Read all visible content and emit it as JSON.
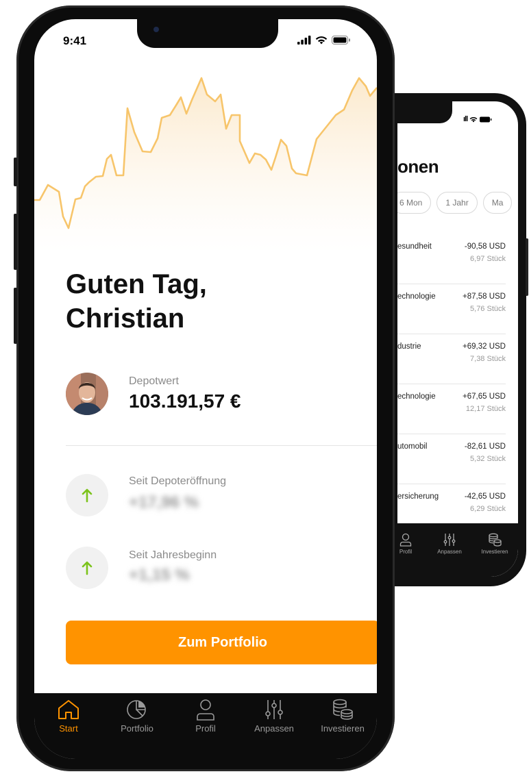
{
  "back": {
    "status_signal": "ıll",
    "title": "onen",
    "filters": [
      "",
      "6 Mon",
      "1 Jahr",
      "Ma"
    ],
    "rows": [
      {
        "sector": "esundheit",
        "amount": "-90,58 USD",
        "qty": "6,97 Stück"
      },
      {
        "sector": "echnologie",
        "amount": "+87,58 USD",
        "qty": "5,76 Stück"
      },
      {
        "sector": "dustrie",
        "amount": "+69,32 USD",
        "qty": "7,38 Stück"
      },
      {
        "sector": "echnologie",
        "amount": "+67,65 USD",
        "qty": "12,17 Stück"
      },
      {
        "sector": "utomobil",
        "amount": "-82,61 USD",
        "qty": "5,32 Stück"
      },
      {
        "sector": "ersicherung",
        "amount": "-42,65 USD",
        "qty": "6,29 Stück"
      }
    ],
    "nav": [
      "Profil",
      "Anpassen",
      "Investieren"
    ]
  },
  "front": {
    "time": "9:41",
    "greeting_line1": "Guten Tag,",
    "greeting_line2": "Christian",
    "depot_label": "Depotwert",
    "depot_value": "103.191,57 €",
    "since_opening_label": "Seit Depoteröffnung",
    "since_opening_value": "+17,96 %",
    "since_year_label": "Seit Jahresbeginn",
    "since_year_value": "+1,15 %",
    "cta": "Zum Portfolio",
    "nav": [
      {
        "label": "Start",
        "icon": "home-icon",
        "active": true
      },
      {
        "label": "Portfolio",
        "icon": "pie-chart-icon",
        "active": false
      },
      {
        "label": "Profil",
        "icon": "user-icon",
        "active": false
      },
      {
        "label": "Anpassen",
        "icon": "sliders-icon",
        "active": false
      },
      {
        "label": "Investieren",
        "icon": "coins-icon",
        "active": false
      }
    ]
  },
  "colors": {
    "accent": "#ff9300",
    "positive": "#7cc31b",
    "chart_line": "#f7c56b"
  }
}
